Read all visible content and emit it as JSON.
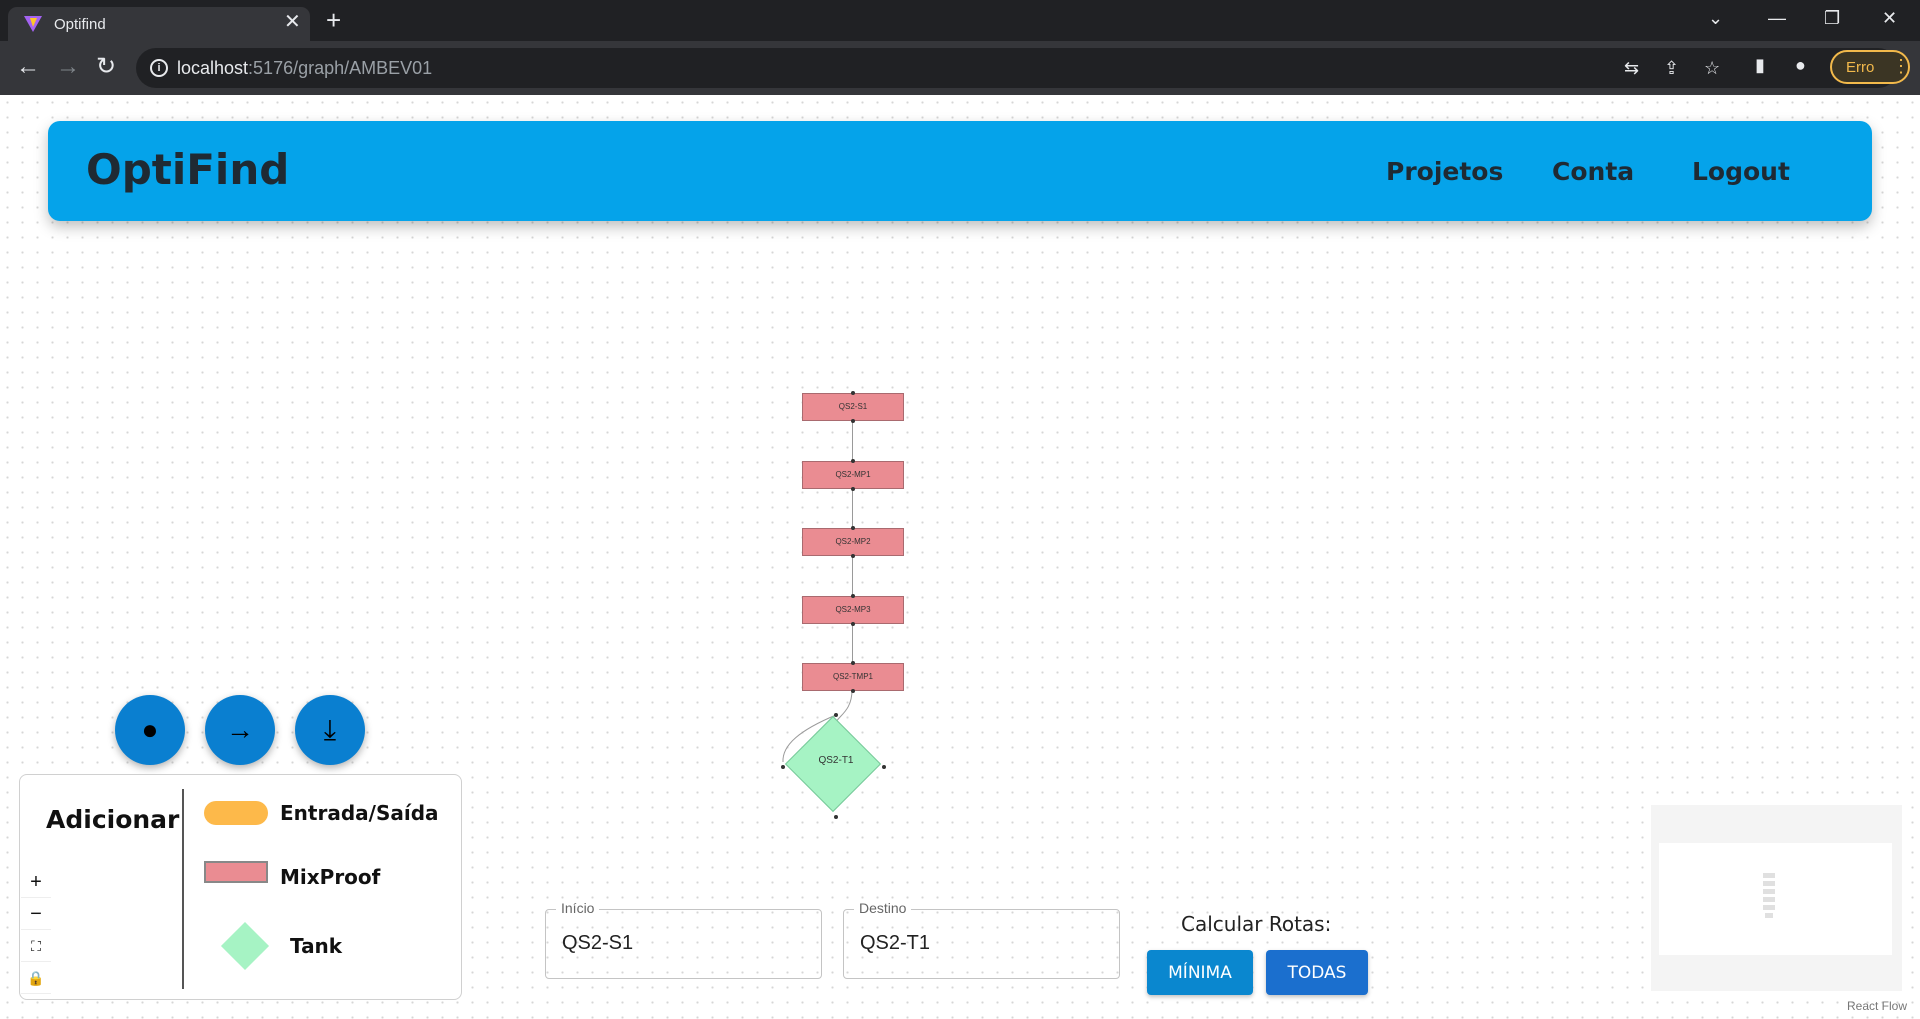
{
  "browser": {
    "tab_title": "Optifind",
    "url_host": "localhost",
    "url_path": ":5176/graph/AMBEV01",
    "profile_label": "Erro"
  },
  "header": {
    "brand": "OptiFind",
    "nav": [
      "Projetos",
      "Conta",
      "Logout"
    ]
  },
  "graph": {
    "nodes": [
      {
        "label": "QS2-S1",
        "type": "MixProof"
      },
      {
        "label": "QS2-MP1",
        "type": "MixProof"
      },
      {
        "label": "QS2-MP2",
        "type": "MixProof"
      },
      {
        "label": "QS2-MP3",
        "type": "MixProof"
      },
      {
        "label": "QS2-TMP1",
        "type": "MixProof"
      },
      {
        "label": "QS2-T1",
        "type": "Tank"
      }
    ]
  },
  "fabs": {
    "node_icon": "filled-circle-icon",
    "edge_icon": "arrow-right-icon",
    "download_icon": "download-icon"
  },
  "add_panel": {
    "title": "Adicionar",
    "items": [
      "Entrada/Saída",
      "MixProof",
      "Tank"
    ],
    "colors": {
      "entrada": "#fdb94a",
      "mixproof": "#ea8c92",
      "tank": "#a6f3c4"
    }
  },
  "route_form": {
    "start_label": "Início",
    "start_value": "QS2-S1",
    "dest_label": "Destino",
    "dest_value": "QS2-T1",
    "calc_label": "Calcular Rotas:",
    "btn_min": "MÍNIMA",
    "btn_all": "TODAS"
  },
  "attribution": "React Flow",
  "colors": {
    "header": "#05a3ea",
    "primary_button": "#0a87cf"
  }
}
